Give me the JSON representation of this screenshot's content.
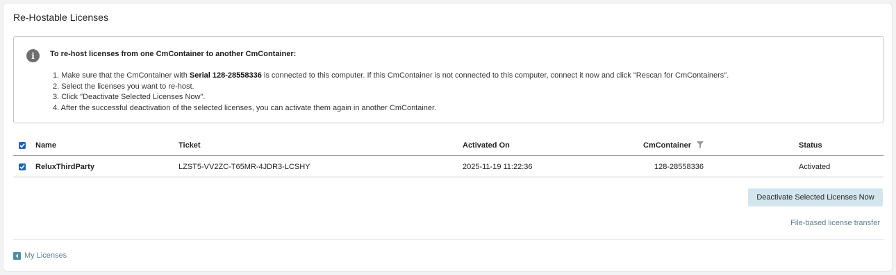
{
  "page_title": "Re-Hostable Licenses",
  "info": {
    "heading": "To re-host licenses from one CmContainer to another CmContainer:",
    "step1_prefix": "1. Make sure that the CmContainer with ",
    "step1_serial": "Serial 128-28558336",
    "step1_suffix": " is connected to this computer. If this CmContainer is not connected to this computer, connect it now and click \"Rescan for CmContainers\".",
    "step2": "2. Select the licenses you want to re-host.",
    "step3": "3. Click \"Deactivate Selected Licenses Now\".",
    "step4": "4. After the successful deactivation of the selected licenses, you can activate them again in another CmContainer."
  },
  "table": {
    "columns": {
      "name": "Name",
      "ticket": "Ticket",
      "activated_on": "Activated On",
      "cmcontainer": "CmContainer",
      "status": "Status"
    },
    "select_all_checked": true,
    "rows": [
      {
        "checked": true,
        "name": "ReluxThirdParty",
        "ticket": "LZST5-VV2ZC-T65MR-4JDR3-LCSHY",
        "activated_on": "2025-11-19 11:22:36",
        "cmcontainer": "128-28558336",
        "status": "Activated"
      }
    ]
  },
  "deactivate_button_label": "Deactivate Selected Licenses Now",
  "file_transfer_link": "File-based license transfer",
  "my_licenses_link": "My Licenses",
  "colors": {
    "accent": "#1e64b4",
    "button_bg": "#d3e5ee",
    "link": "#5e7f8e",
    "info_icon": "#6e6e6e"
  }
}
